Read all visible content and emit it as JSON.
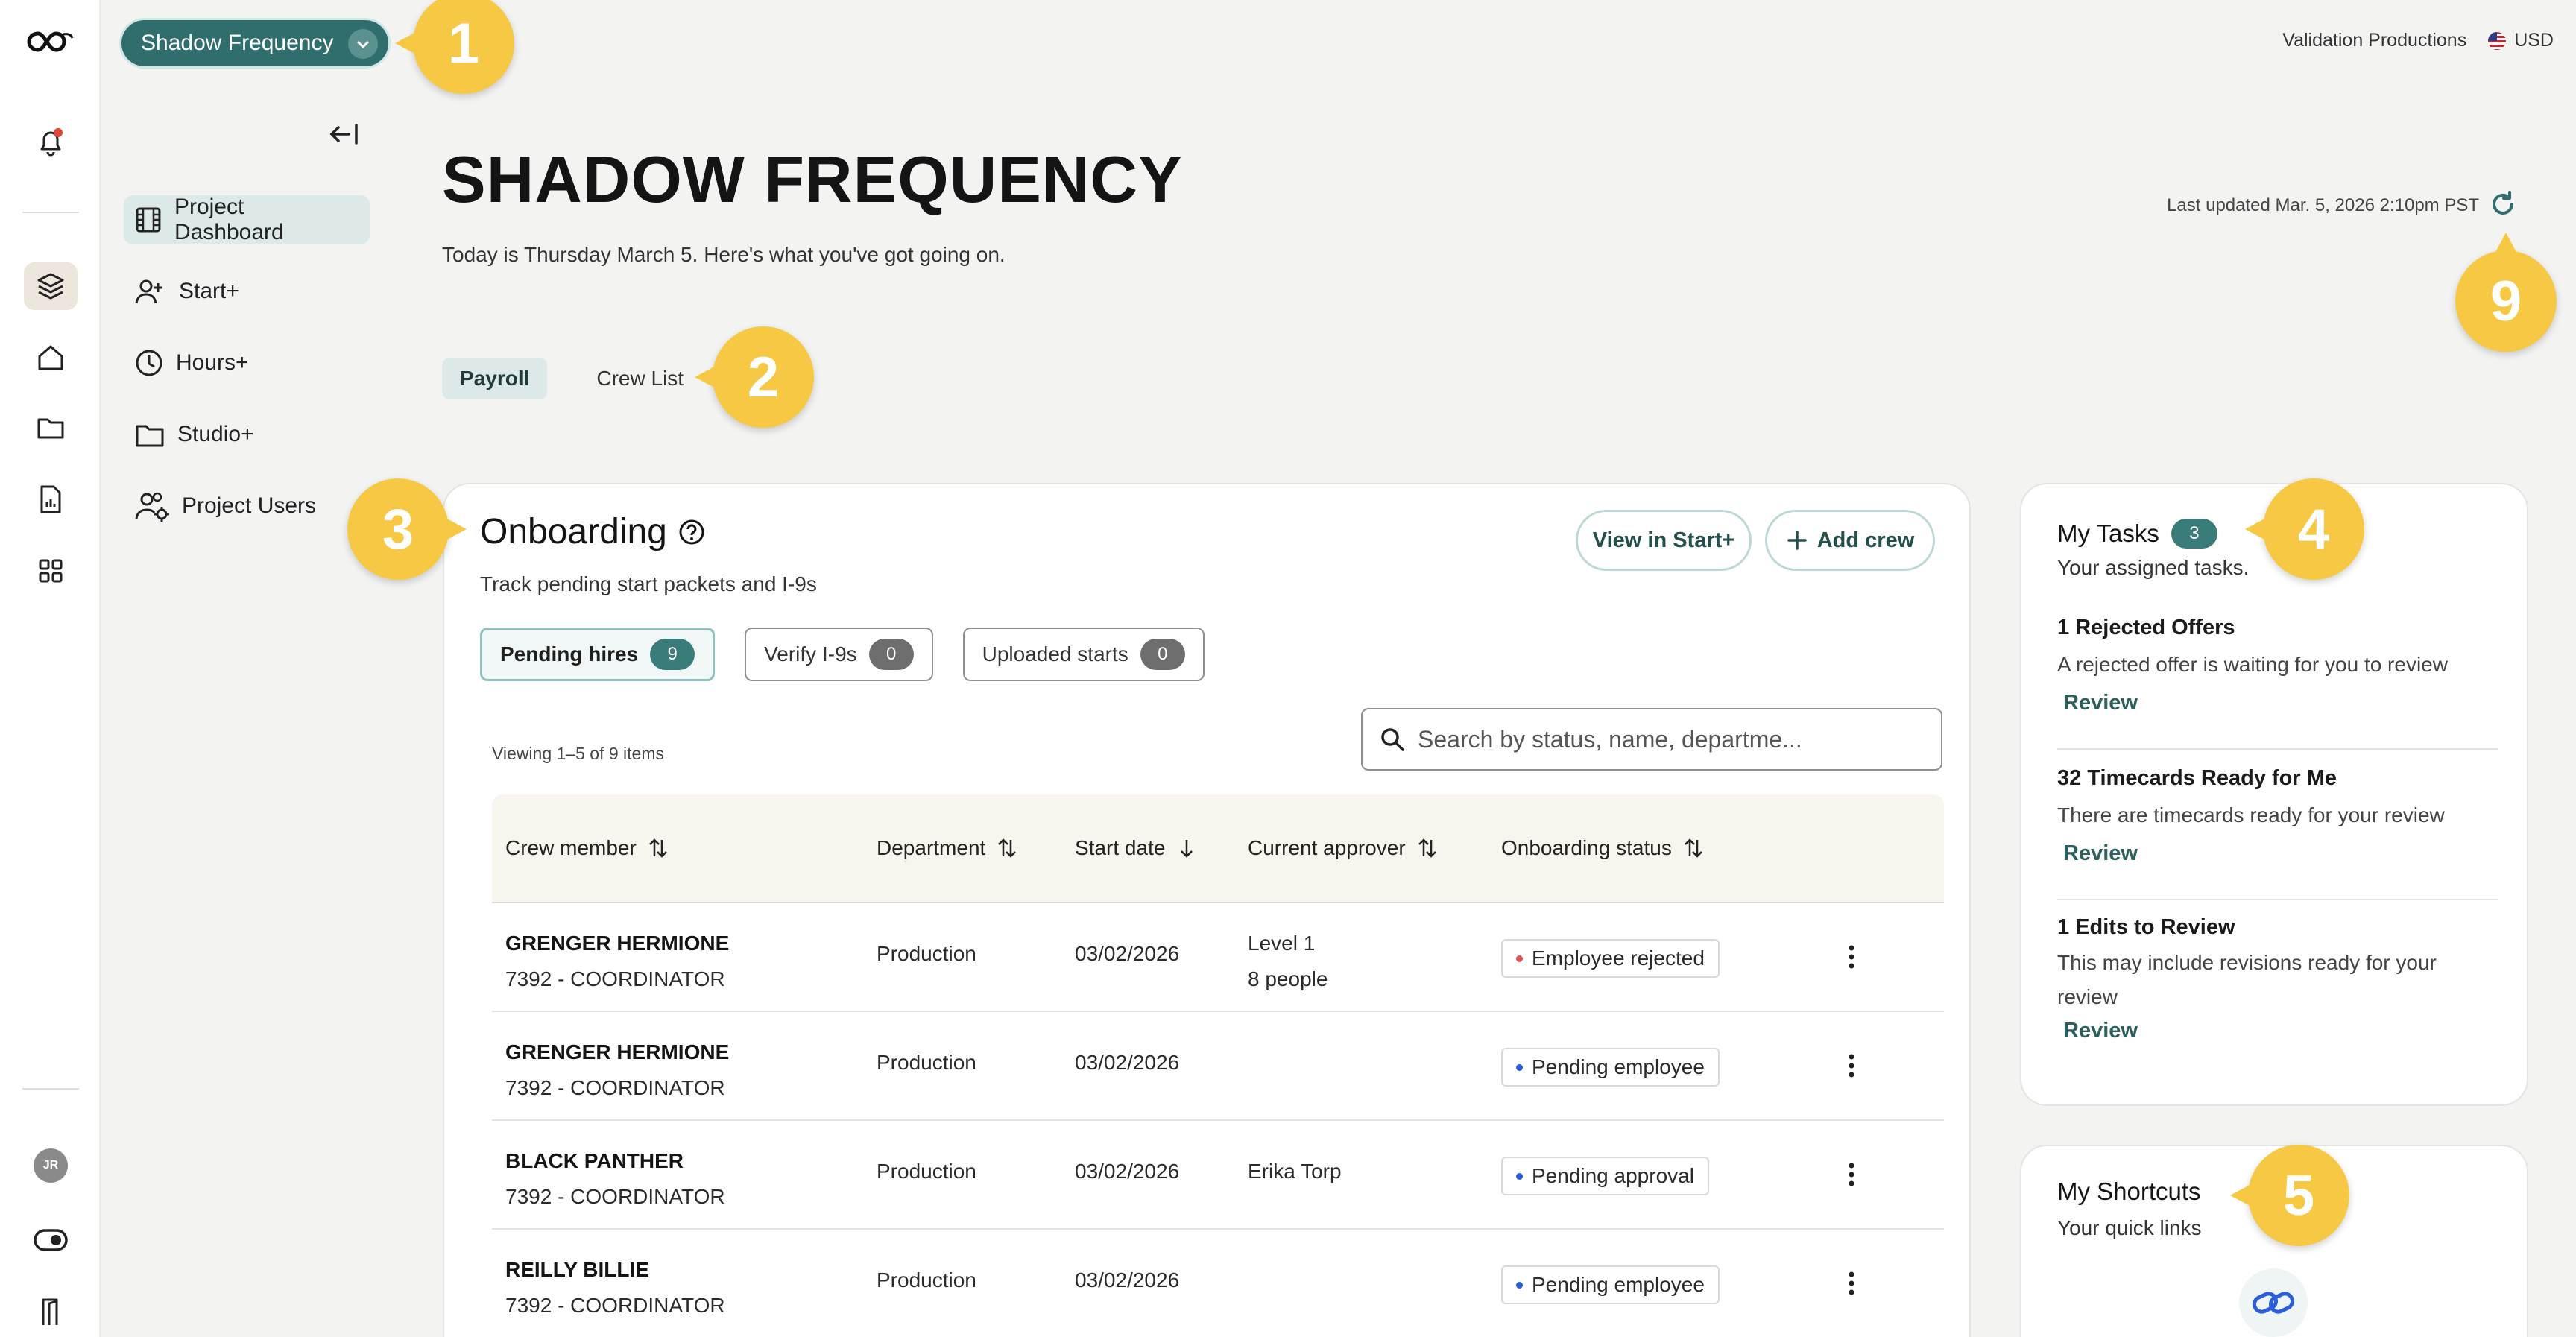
{
  "app": {
    "project_selector": "Shadow Frequency",
    "company": "Validation Productions",
    "currency": "USD"
  },
  "sidebar": {
    "items": [
      {
        "label": "Project Dashboard"
      },
      {
        "label": "Start+"
      },
      {
        "label": "Hours+"
      },
      {
        "label": "Studio+"
      },
      {
        "label": "Project Users"
      }
    ]
  },
  "rail": {
    "avatar_initials": "JR"
  },
  "header": {
    "title": "SHADOW FREQUENCY",
    "subtitle": "Today is Thursday March 5. Here's what you've got going on.",
    "last_updated": "Last updated Mar. 5, 2026 2:10pm PST"
  },
  "tabs": [
    {
      "label": "Payroll",
      "active": true
    },
    {
      "label": "Crew List",
      "active": false
    }
  ],
  "onboarding": {
    "title": "Onboarding",
    "subtitle": "Track pending start packets and I-9s",
    "view_button": "View in Start+",
    "add_button": "Add crew",
    "chips": [
      {
        "label": "Pending hires",
        "count": "9"
      },
      {
        "label": "Verify I-9s",
        "count": "0"
      },
      {
        "label": "Uploaded starts",
        "count": "0"
      }
    ],
    "viewing": "Viewing 1–5 of 9 items",
    "search_placeholder": "Search by status, name, departme...",
    "columns": [
      "Crew member",
      "Department",
      "Start date",
      "Current approver",
      "Onboarding status"
    ],
    "rows": [
      {
        "name": "GRENGER HERMIONE",
        "role": "7392 - COORDINATOR",
        "department": "Production",
        "start_date": "03/02/2026",
        "approver_1": "Level 1",
        "approver_2": "8 people",
        "status": "Employee rejected"
      },
      {
        "name": "GRENGER HERMIONE",
        "role": "7392 - COORDINATOR",
        "department": "Production",
        "start_date": "03/02/2026",
        "approver_1": "",
        "approver_2": "",
        "status": "Pending employee"
      },
      {
        "name": "BLACK PANTHER",
        "role": "7392 - COORDINATOR",
        "department": "Production",
        "start_date": "03/02/2026",
        "approver_1": "Erika Torp",
        "approver_2": "",
        "status": "Pending approval"
      },
      {
        "name": "REILLY BILLIE",
        "role": "7392 - COORDINATOR",
        "department": "Production",
        "start_date": "03/02/2026",
        "approver_1": "",
        "approver_2": "",
        "status": "Pending employee"
      }
    ]
  },
  "tasks": {
    "title": "My Tasks",
    "count": "3",
    "subtitle": "Your assigned tasks.",
    "items": [
      {
        "title": "1 Rejected Offers",
        "desc": "A rejected offer is waiting for you to review",
        "link": "Review"
      },
      {
        "title": "32 Timecards Ready for Me",
        "desc": "There are timecards ready for your review",
        "link": "Review"
      },
      {
        "title": "1 Edits to Review",
        "desc": "This may include revisions ready for your review",
        "link": "Review"
      }
    ]
  },
  "shortcuts": {
    "title": "My Shortcuts",
    "subtitle": "Your quick links"
  },
  "callouts": [
    "1",
    "2",
    "3",
    "4",
    "5",
    "9"
  ],
  "colors": {
    "accent": "#2f6e6c",
    "callout": "#f7c843",
    "status_rejected": "#d9534f",
    "status_pending": "#2b5fd9"
  }
}
